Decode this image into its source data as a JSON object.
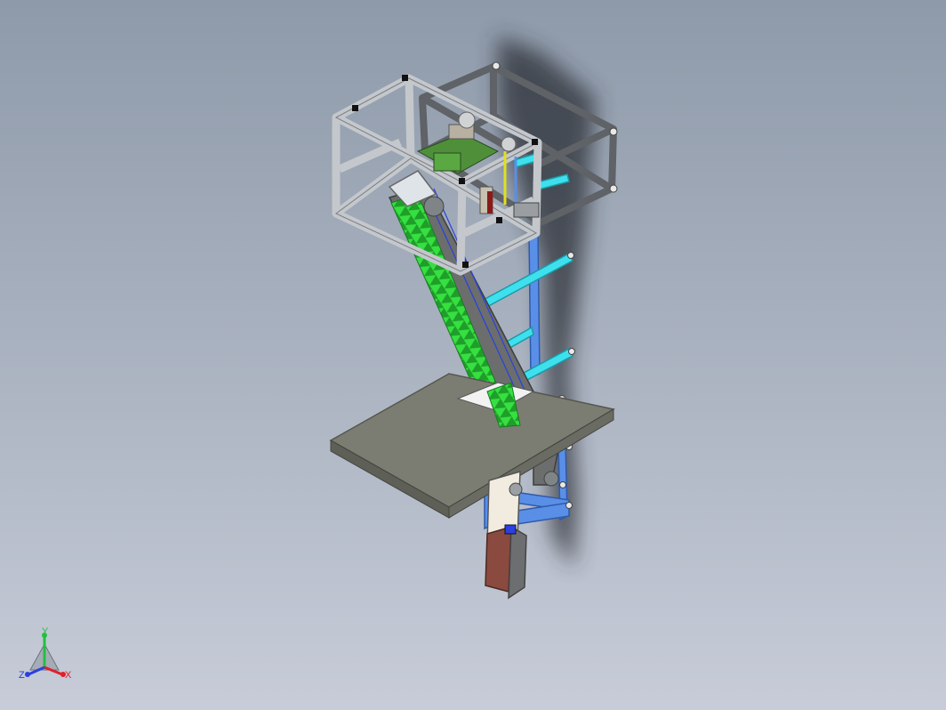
{
  "app": {
    "view": "isometric",
    "background_top": "#8e9aaa",
    "background_bottom": "#c7ccd8"
  },
  "triad": {
    "x_label": "X",
    "y_label": "Y",
    "z_label": "Z",
    "x_color": "#e0202a",
    "y_color": "#22c040",
    "z_color": "#2a40e0"
  },
  "model": {
    "frame_color": "#c4c8cc",
    "plate_color": "#7c7d72",
    "conveyor_color": "#22c02c",
    "support_color": "#5a8fe8",
    "rail_color": "#3ee0ee",
    "motor_color": "#8a4a40"
  }
}
